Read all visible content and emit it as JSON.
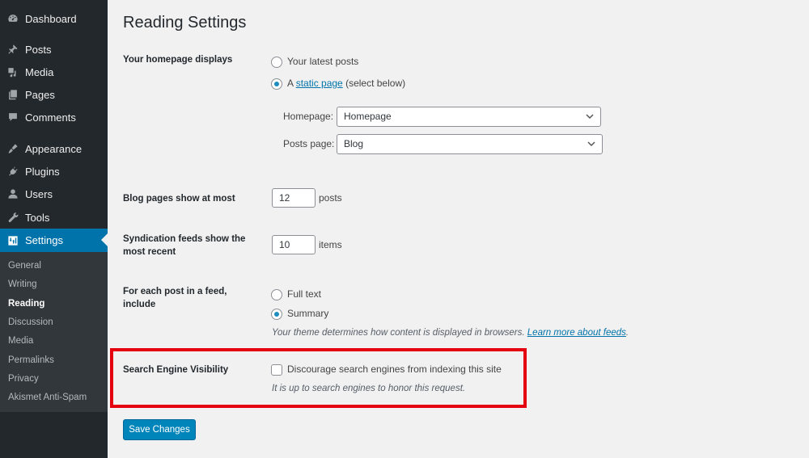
{
  "sidebar": {
    "items": [
      {
        "label": "Dashboard",
        "icon": "dashboard-icon"
      },
      {
        "label": "Posts",
        "icon": "pin-icon"
      },
      {
        "label": "Media",
        "icon": "media-icon"
      },
      {
        "label": "Pages",
        "icon": "pages-icon"
      },
      {
        "label": "Comments",
        "icon": "comment-icon"
      },
      {
        "label": "Appearance",
        "icon": "brush-icon"
      },
      {
        "label": "Plugins",
        "icon": "plug-icon"
      },
      {
        "label": "Users",
        "icon": "user-icon"
      },
      {
        "label": "Tools",
        "icon": "wrench-icon"
      },
      {
        "label": "Settings",
        "icon": "settings-icon",
        "active": true
      }
    ],
    "submenu": [
      {
        "label": "General"
      },
      {
        "label": "Writing"
      },
      {
        "label": "Reading",
        "current": true
      },
      {
        "label": "Discussion"
      },
      {
        "label": "Media"
      },
      {
        "label": "Permalinks"
      },
      {
        "label": "Privacy"
      },
      {
        "label": "Akismet Anti-Spam"
      }
    ]
  },
  "page": {
    "title": "Reading Settings",
    "homepage_displays": {
      "label": "Your homepage displays",
      "option_latest": "Your latest posts",
      "option_static_prefix": "A",
      "option_static_link": "static page",
      "option_static_suffix": "(select below)",
      "selected": "static",
      "homepage_label": "Homepage:",
      "homepage_value": "Homepage",
      "posts_page_label": "Posts page:",
      "posts_page_value": "Blog"
    },
    "blog_pages": {
      "label": "Blog pages show at most",
      "value": "12",
      "unit": "posts"
    },
    "syndication": {
      "label": "Syndication feeds show the most recent",
      "value": "10",
      "unit": "items"
    },
    "feed_include": {
      "label": "For each post in a feed, include",
      "option_full": "Full text",
      "option_summary": "Summary",
      "selected": "summary",
      "description": "Your theme determines how content is displayed in browsers.",
      "learn_more": "Learn more about feeds",
      "period": "."
    },
    "search_visibility": {
      "label": "Search Engine Visibility",
      "checkbox_label": "Discourage search engines from indexing this site",
      "checked": false,
      "description": "It is up to search engines to honor this request."
    },
    "save_label": "Save Changes"
  },
  "colors": {
    "sidebar_bg": "#23282d",
    "submenu_bg": "#32373c",
    "active_bg": "#0073aa",
    "primary_button": "#0085ba",
    "highlight_border": "#e4000f",
    "link": "#0073aa"
  }
}
